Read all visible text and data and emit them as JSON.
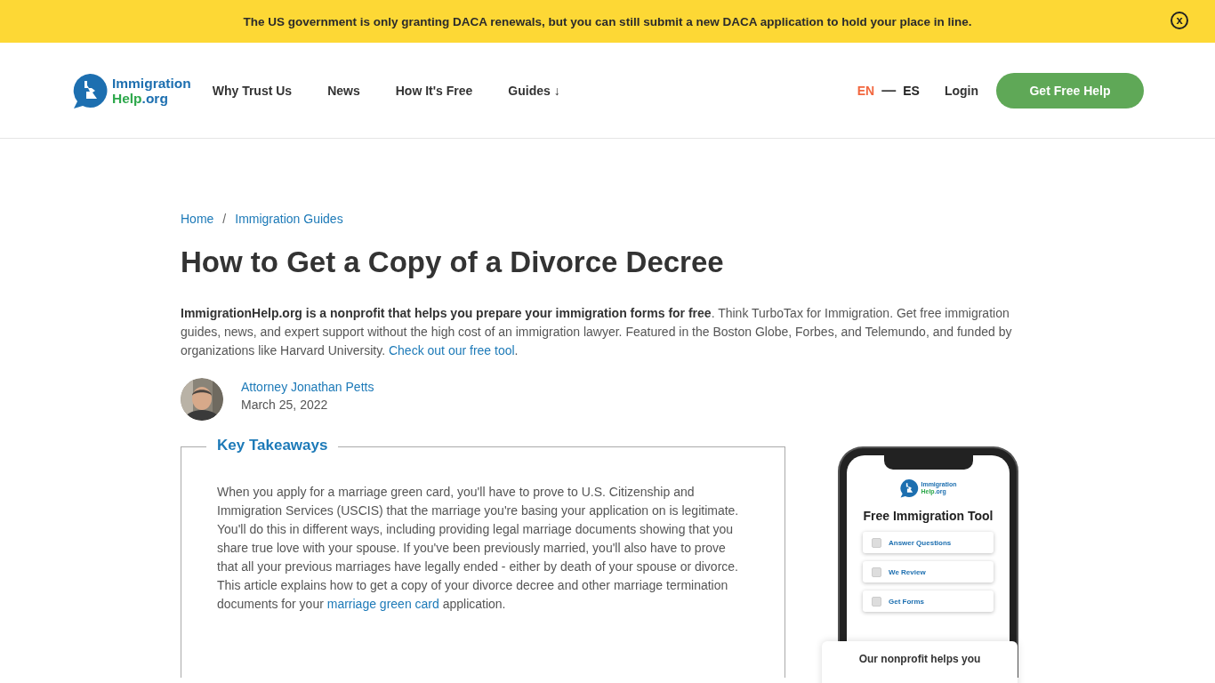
{
  "banner": {
    "text": "The US government is only granting DACA renewals, but you can still submit a new DACA application to hold your place in line.",
    "close": "x"
  },
  "header": {
    "logo": {
      "line1": "Immigration",
      "line2a": "Help",
      "line2b": ".org"
    },
    "nav": [
      {
        "label": "Why Trust Us"
      },
      {
        "label": "News"
      },
      {
        "label": "How It's Free"
      },
      {
        "label": "Guides ↓"
      }
    ],
    "languages": [
      {
        "label": "EN",
        "selected": true
      },
      {
        "label": "ES",
        "selected": false
      }
    ],
    "separator": "—",
    "login": "Login",
    "cta": "Get Free Help"
  },
  "breadcrumb": [
    {
      "label": "Home"
    },
    {
      "label": "Immigration Guides"
    }
  ],
  "breadcrumb_separator": "/",
  "title": "How to Get a Copy of a Divorce Decree",
  "intro": {
    "bold": "ImmigrationHelp.org is a nonprofit that helps you prepare your immigration forms for free",
    "text": ". Think TurboTax for Immigration. Get free immigration guides, news, and expert support without the high cost of an immigration lawyer. Featured in the Boston Globe, Forbes, and Telemundo, and funded by organizations like Harvard University. ",
    "link": "Check out our free tool",
    "end": "."
  },
  "author": {
    "name": "Attorney Jonathan Petts",
    "date": "March 25, 2022"
  },
  "takeaways": {
    "title": "Key Takeaways",
    "text": "When you apply for a marriage green card, you'll have to prove to U.S. Citizenship and Immigration Services (USCIS) that the marriage you're basing your application on is legitimate. You'll do this in different ways, including providing legal marriage documents showing that you share true love with your spouse. If you've been previously married, you'll also have to prove that all your previous marriages have legally ended - either by death of your spouse or divorce. This article explains how to get a copy of your divorce decree and other marriage termination documents for your ",
    "link": "marriage green card",
    "end": " application."
  },
  "promo": {
    "logo": {
      "line1": "Immigration",
      "line2a": "Help",
      "line2b": ".org"
    },
    "title": "Free Immigration Tool",
    "steps": [
      {
        "label": "Answer Questions",
        "checked": false
      },
      {
        "label": "We Review",
        "checked": false
      },
      {
        "label": "Get Forms",
        "checked": false
      }
    ],
    "card_text": "Our nonprofit helps you"
  }
}
